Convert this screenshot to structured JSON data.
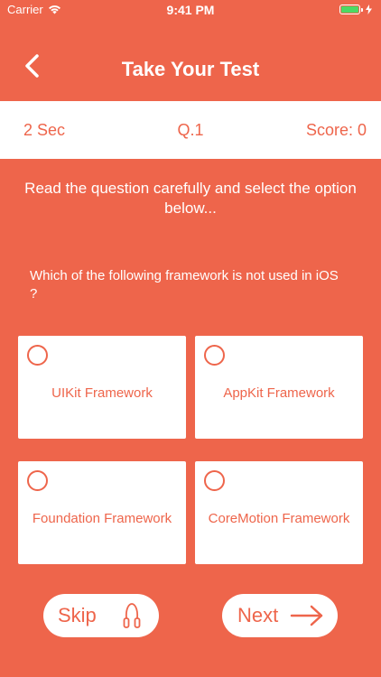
{
  "status_bar": {
    "carrier": "Carrier",
    "time": "9:41 PM"
  },
  "nav": {
    "title": "Take Your Test"
  },
  "info": {
    "timer": "2 Sec",
    "question_number": "Q.1",
    "score": "Score: 0"
  },
  "instruction": "Read the question carefully and select the option below...",
  "question": "Which of the following framework is not used in iOS ?",
  "options": [
    {
      "label": "UIKit Framework"
    },
    {
      "label": "AppKit Framework"
    },
    {
      "label": "Foundation Framework"
    },
    {
      "label": "CoreMotion Framework"
    }
  ],
  "buttons": {
    "skip": "Skip",
    "next": "Next"
  },
  "colors": {
    "primary": "#EE654B",
    "surface": "#FFFFFF",
    "battery": "#4CD964"
  }
}
